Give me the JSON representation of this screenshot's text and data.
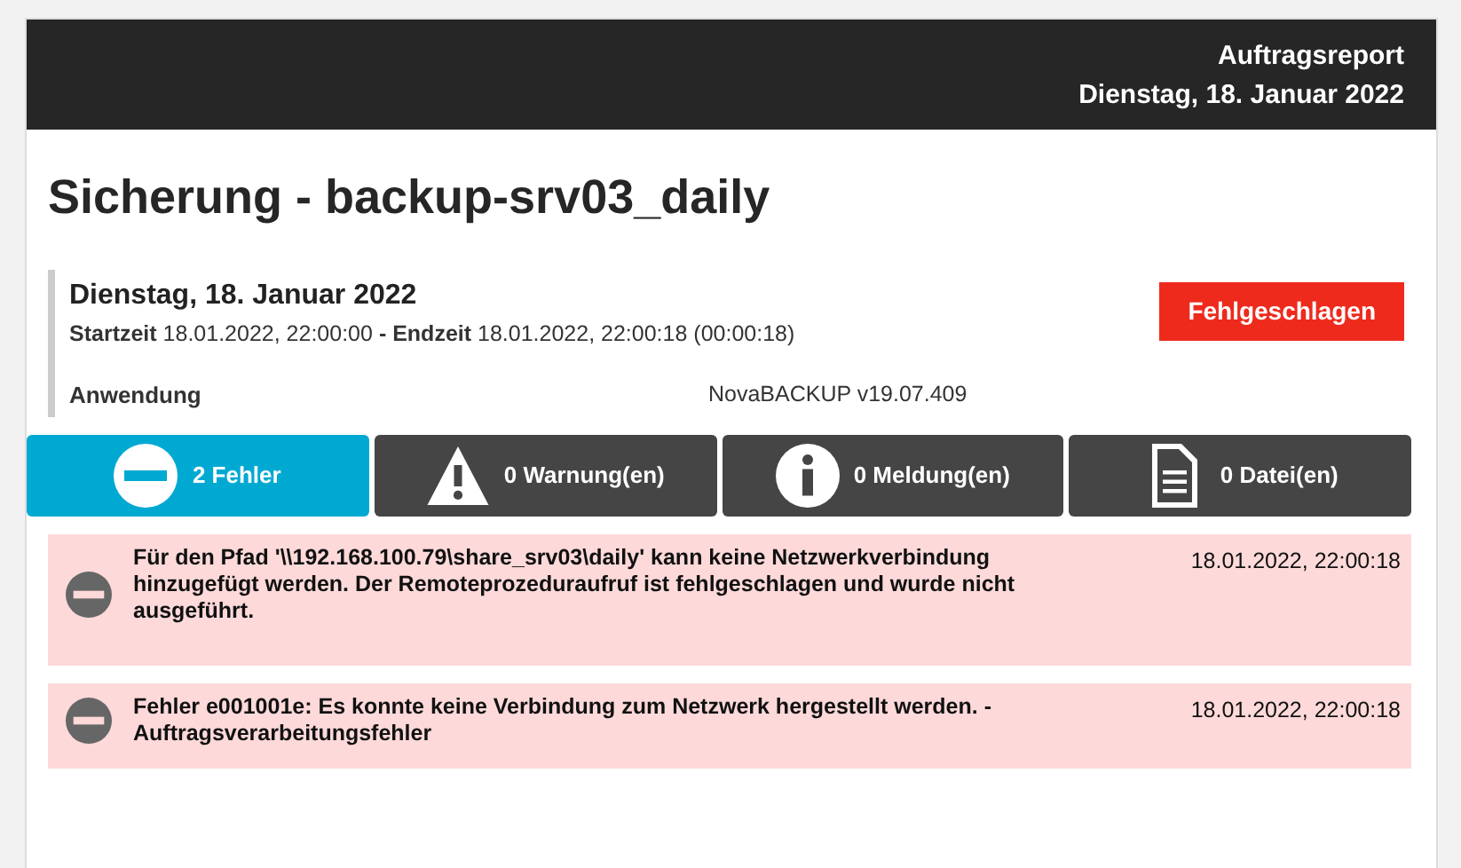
{
  "header": {
    "title": "Auftragsreport",
    "date": "Dienstag, 18. Januar 2022"
  },
  "job_title": "Sicherung - backup-srv03_daily",
  "summary": {
    "date": "Dienstag, 18. Januar 2022",
    "times": "**Startzeit** 18.01.2022, 22:00:00 **- Endzeit** 18.01.2022, 22:00:18 (00:00:18)",
    "status": "Fehlgeschlagen",
    "application_label": "Anwendung",
    "application_value": "NovaBACKUP v19.07.409"
  },
  "tabs": [
    {
      "kind": "error",
      "label": "2 Fehler",
      "selected": true
    },
    {
      "kind": "warning",
      "label": "0 Warnung(en)",
      "selected": false
    },
    {
      "kind": "info",
      "label": "0 Meldung(en)",
      "selected": false
    },
    {
      "kind": "file",
      "label": "0 Datei(en)",
      "selected": false
    }
  ],
  "messages": [
    {
      "kind": "error",
      "text": "Für den Pfad '\\\\192.168.100.79\\share_srv03\\daily' kann keine Netzwerkverbindung hinzugefügt werden. Der Remoteprozeduraufruf ist fehlgeschlagen und wurde nicht ausgeführt.",
      "time": "18.01.2022, 22:00:18"
    },
    {
      "kind": "error",
      "text": "Fehler e001001e: Es konnte keine Verbindung zum Netzwerk hergestellt werden. - Auftragsverarbeitungsfehler",
      "time": "18.01.2022, 22:00:18"
    }
  ]
}
